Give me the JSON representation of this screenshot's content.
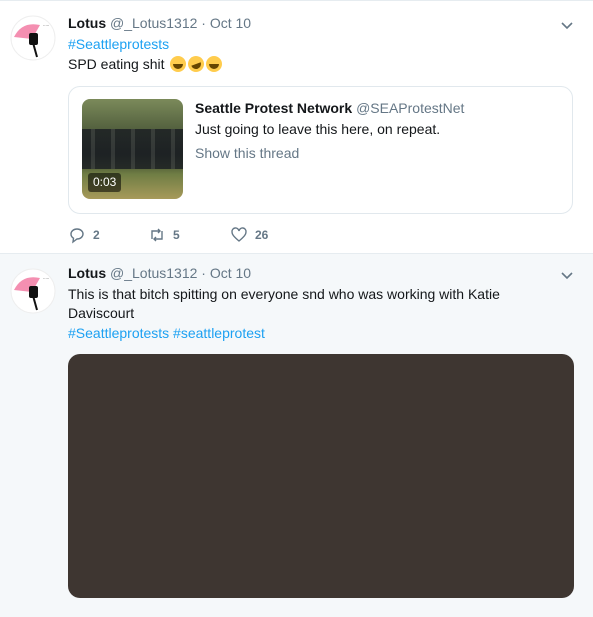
{
  "colors": {
    "accent": "#1da1f2",
    "muted": "#657786",
    "media_bg": "#3e3631"
  },
  "tweets": [
    {
      "name": "Lotus",
      "handle": "@_Lotus1312",
      "dot": "·",
      "date": "Oct 10",
      "hashtag": "#Seattleprotests",
      "text": "SPD eating shit",
      "emojis": [
        "sweat-smile-emoji",
        "rofl-emoji",
        "joy-emoji"
      ],
      "quote": {
        "name": "Seattle Protest Network",
        "handle": "@SEAProtestNet",
        "text": "Just going to leave this here, on repeat.",
        "link": "Show this thread",
        "duration": "0:03"
      },
      "actions": {
        "replies": "2",
        "retweets": "5",
        "likes": "26"
      }
    },
    {
      "name": "Lotus",
      "handle": "@_Lotus1312",
      "dot": "·",
      "date": "Oct 10",
      "text_line1": "This is that bitch spitting on everyone snd who was working with Katie",
      "text_line2": "Daviscourt",
      "hashtags": "#Seattleprotests #seattleprotest"
    }
  ]
}
